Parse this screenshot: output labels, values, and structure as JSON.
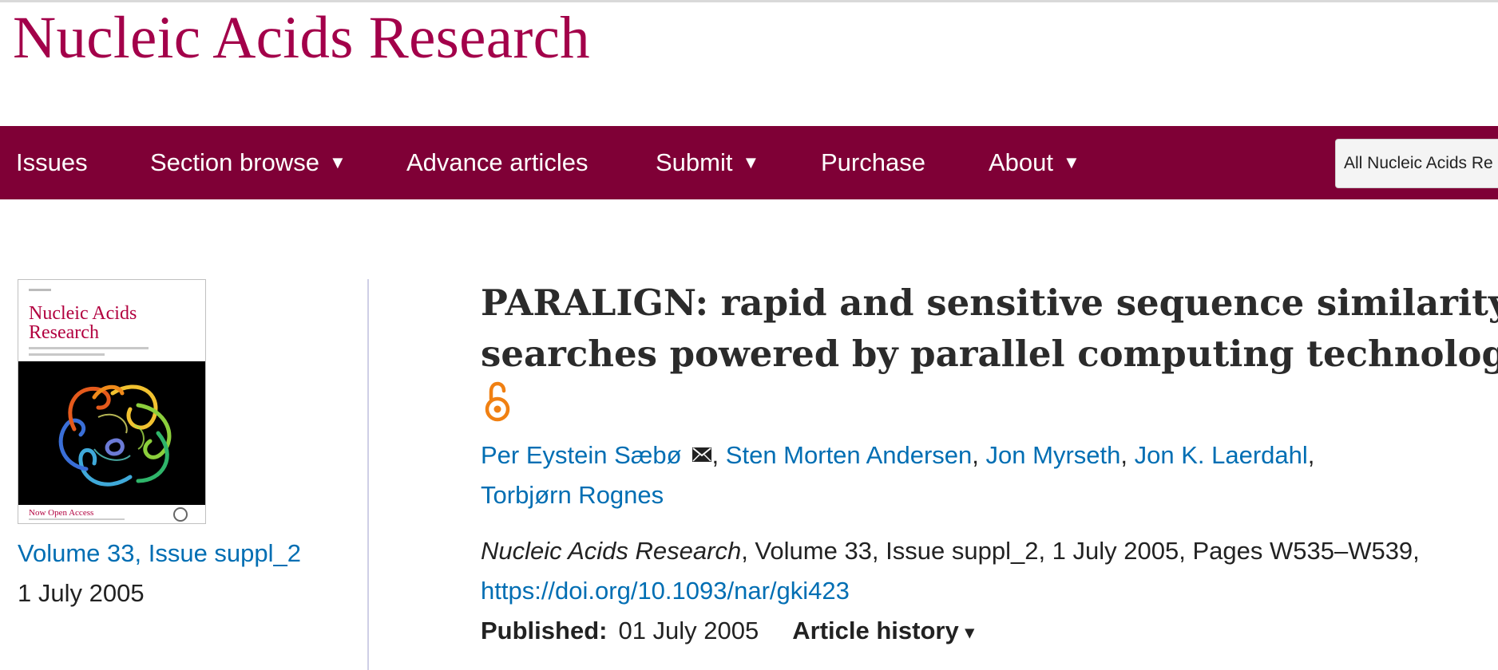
{
  "journal": {
    "title": "Nucleic Acids Research"
  },
  "nav": {
    "items": [
      {
        "label": "Issues",
        "caret": ""
      },
      {
        "label": "Section browse",
        "caret": "▼"
      },
      {
        "label": "Advance articles",
        "caret": ""
      },
      {
        "label": "Submit",
        "caret": "▼"
      },
      {
        "label": "Purchase",
        "caret": ""
      },
      {
        "label": "About",
        "caret": "▼"
      }
    ],
    "search_scope": "All Nucleic Acids Re"
  },
  "issue": {
    "cover": {
      "title_line1": "Nucleic Acids",
      "title_line2": "Research",
      "footer_text": "Now Open Access"
    },
    "link": "Volume 33, Issue suppl_2",
    "date": "1 July 2005"
  },
  "article": {
    "title_line1": "PARALIGN: rapid and sensitive sequence similarity",
    "title_line2": "searches powered by parallel computing technology",
    "open_access_icon": "open-access-lock-icon",
    "authors": [
      "Per Eystein Sæbø",
      "Sten Morten Andersen",
      "Jon Myrseth",
      "Jon K. Laerdahl",
      "Torbjørn Rognes"
    ],
    "separator": ",",
    "citation": {
      "journal": "Nucleic Acids Research",
      "details": ", Volume 33, Issue suppl_2, 1 July 2005, Pages W535–W539,",
      "doi": "https://doi.org/10.1093/nar/gki423"
    },
    "published_label": "Published:",
    "published_date": "01 July 2005",
    "history_label": "Article history",
    "history_caret": "▾"
  },
  "colors": {
    "brand": "#a3004a",
    "navbar": "#7f0036",
    "link": "#006eb3",
    "open_access": "#f08012"
  }
}
